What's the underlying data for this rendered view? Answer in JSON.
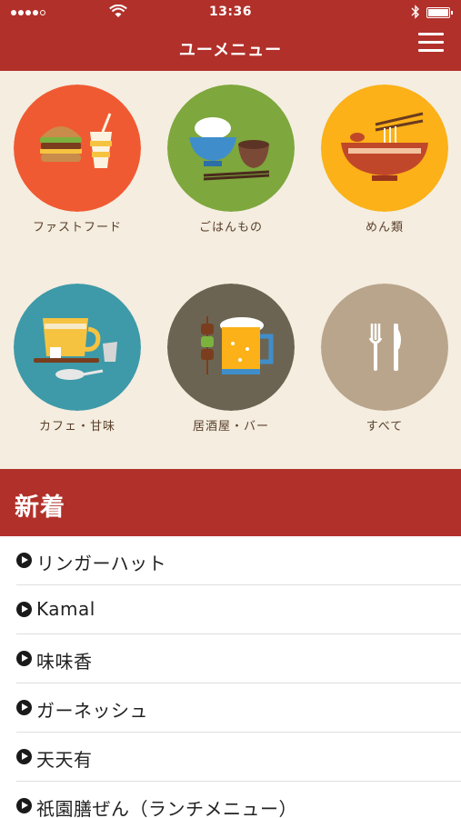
{
  "status_bar": {
    "time": "13:36"
  },
  "header": {
    "title": "ユーメニュー"
  },
  "categories": [
    {
      "label": "ファストフード",
      "icon": "hamburger-drink-icon",
      "color": "#f05a32"
    },
    {
      "label": "ごはんもの",
      "icon": "rice-bowl-icon",
      "color": "#7ea73d"
    },
    {
      "label": "めん類",
      "icon": "noodle-bowl-icon",
      "color": "#fbb117"
    },
    {
      "label": "カフェ・甘味",
      "icon": "coffee-cup-icon",
      "color": "#3e9aa8"
    },
    {
      "label": "居酒屋・バー",
      "icon": "beer-skewer-icon",
      "color": "#6c6452"
    },
    {
      "label": "すべて",
      "icon": "fork-knife-icon",
      "color": "#b9a58c"
    }
  ],
  "new_section": {
    "title": "新着",
    "items": [
      "リンガーハット",
      "Kamal",
      "味味香",
      "ガーネッシュ",
      "天天有",
      "祇園膳ぜん（ランチメニュー）"
    ]
  },
  "colors": {
    "primary": "#b1302a",
    "background": "#f4ede0",
    "label_text": "#5a3f2a"
  }
}
